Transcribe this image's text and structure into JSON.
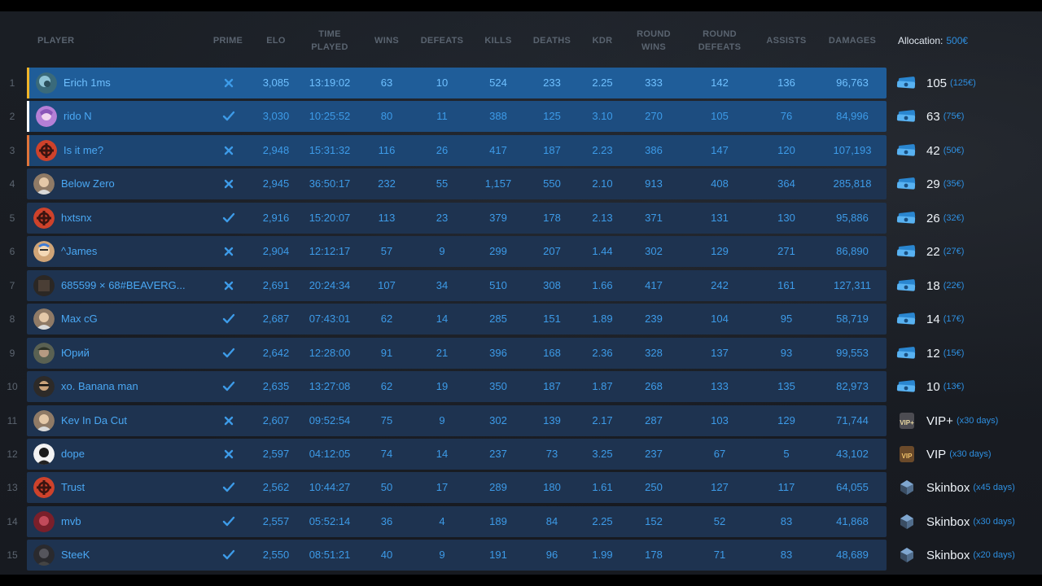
{
  "columns": {
    "player": "PLAYER",
    "prime": "PRIME",
    "elo": "ELO",
    "time_played": "TIME PLAYED",
    "wins": "WINS",
    "defeats": "DEFEATS",
    "kills": "KILLS",
    "deaths": "DEATHS",
    "kdr": "KDR",
    "round_wins": "ROUND WINS",
    "round_defeats": "ROUND DEFEATS",
    "assists": "ASSISTS",
    "damages": "DAMAGES"
  },
  "allocation": {
    "label": "Allocation:",
    "amount": "500€"
  },
  "colors": {
    "accent_blue": "#2e8fe0",
    "rank1_accent": "#f0b429",
    "rank2_accent": "#ffffff",
    "rank3_accent": "#e0743a",
    "cross": "#3d9be8",
    "check": "#3d9be8"
  },
  "rows": [
    {
      "rank": "1",
      "name": "Erich 1ms",
      "avatar": "globe-avatar",
      "prime": false,
      "elo": "3,085",
      "time": "13:19:02",
      "wins": "63",
      "defeats": "10",
      "kills": "524",
      "deaths": "233",
      "kdr": "2.25",
      "round_wins": "333",
      "round_defeats": "142",
      "assists": "136",
      "damages": "96,763",
      "reward": "105",
      "reward_sub": "(125€)",
      "reward_icon": "cash-icon"
    },
    {
      "rank": "2",
      "name": "rido N",
      "avatar": "anime-avatar",
      "prime": true,
      "elo": "3,030",
      "time": "10:25:52",
      "wins": "80",
      "defeats": "11",
      "kills": "388",
      "deaths": "125",
      "kdr": "3.10",
      "round_wins": "270",
      "round_defeats": "105",
      "assists": "76",
      "damages": "84,996",
      "reward": "63",
      "reward_sub": "(75€)",
      "reward_icon": "cash-icon"
    },
    {
      "rank": "3",
      "name": "Is it me?",
      "avatar": "rust-logo-avatar",
      "prime": false,
      "elo": "2,948",
      "time": "15:31:32",
      "wins": "116",
      "defeats": "26",
      "kills": "417",
      "deaths": "187",
      "kdr": "2.23",
      "round_wins": "386",
      "round_defeats": "147",
      "assists": "120",
      "damages": "107,193",
      "reward": "42",
      "reward_sub": "(50€)",
      "reward_icon": "cash-icon"
    },
    {
      "rank": "4",
      "name": "Below Zero",
      "avatar": "face-avatar",
      "prime": false,
      "elo": "2,945",
      "time": "36:50:17",
      "wins": "232",
      "defeats": "55",
      "kills": "1,157",
      "deaths": "550",
      "kdr": "2.10",
      "round_wins": "913",
      "round_defeats": "408",
      "assists": "364",
      "damages": "285,818",
      "reward": "29",
      "reward_sub": "(35€)",
      "reward_icon": "cash-icon"
    },
    {
      "rank": "5",
      "name": "hxtsnx",
      "avatar": "rust-logo-avatar",
      "prime": true,
      "elo": "2,916",
      "time": "15:20:07",
      "wins": "113",
      "defeats": "23",
      "kills": "379",
      "deaths": "178",
      "kdr": "2.13",
      "round_wins": "371",
      "round_defeats": "131",
      "assists": "130",
      "damages": "95,886",
      "reward": "26",
      "reward_sub": "(32€)",
      "reward_icon": "cash-icon"
    },
    {
      "rank": "6",
      "name": "^James",
      "avatar": "cartoon-avatar",
      "prime": false,
      "elo": "2,904",
      "time": "12:12:17",
      "wins": "57",
      "defeats": "9",
      "kills": "299",
      "deaths": "207",
      "kdr": "1.44",
      "round_wins": "302",
      "round_defeats": "129",
      "assists": "271",
      "damages": "86,890",
      "reward": "22",
      "reward_sub": "(27€)",
      "reward_icon": "cash-icon"
    },
    {
      "rank": "7",
      "name": "685599 × 68#BEAVERG...",
      "avatar": "dark-square-avatar",
      "prime": false,
      "elo": "2,691",
      "time": "20:24:34",
      "wins": "107",
      "defeats": "34",
      "kills": "510",
      "deaths": "308",
      "kdr": "1.66",
      "round_wins": "417",
      "round_defeats": "242",
      "assists": "161",
      "damages": "127,311",
      "reward": "18",
      "reward_sub": "(22€)",
      "reward_icon": "cash-icon"
    },
    {
      "rank": "8",
      "name": "Max cG",
      "avatar": "face-avatar",
      "prime": true,
      "elo": "2,687",
      "time": "07:43:01",
      "wins": "62",
      "defeats": "14",
      "kills": "285",
      "deaths": "151",
      "kdr": "1.89",
      "round_wins": "239",
      "round_defeats": "104",
      "assists": "95",
      "damages": "58,719",
      "reward": "14",
      "reward_sub": "(17€)",
      "reward_icon": "cash-icon"
    },
    {
      "rank": "9",
      "name": "Юрий",
      "avatar": "soldier-avatar",
      "prime": true,
      "elo": "2,642",
      "time": "12:28:00",
      "wins": "91",
      "defeats": "21",
      "kills": "396",
      "deaths": "168",
      "kdr": "2.36",
      "round_wins": "328",
      "round_defeats": "137",
      "assists": "93",
      "damages": "99,553",
      "reward": "12",
      "reward_sub": "(15€)",
      "reward_icon": "cash-icon"
    },
    {
      "rank": "10",
      "name": "xo. Banana man",
      "avatar": "character-avatar",
      "prime": true,
      "elo": "2,635",
      "time": "13:27:08",
      "wins": "62",
      "defeats": "19",
      "kills": "350",
      "deaths": "187",
      "kdr": "1.87",
      "round_wins": "268",
      "round_defeats": "133",
      "assists": "135",
      "damages": "82,973",
      "reward": "10",
      "reward_sub": "(13€)",
      "reward_icon": "cash-icon"
    },
    {
      "rank": "11",
      "name": "Kev In Da Cut",
      "avatar": "face-avatar",
      "prime": false,
      "elo": "2,607",
      "time": "09:52:54",
      "wins": "75",
      "defeats": "9",
      "kills": "302",
      "deaths": "139",
      "kdr": "2.17",
      "round_wins": "287",
      "round_defeats": "103",
      "assists": "129",
      "damages": "71,744",
      "reward": "VIP+",
      "reward_sub": "(x30 days)",
      "reward_icon": "vip-plus-icon"
    },
    {
      "rank": "12",
      "name": "dope",
      "avatar": "bw-avatar",
      "prime": false,
      "elo": "2,597",
      "time": "04:12:05",
      "wins": "74",
      "defeats": "14",
      "kills": "237",
      "deaths": "73",
      "kdr": "3.25",
      "round_wins": "237",
      "round_defeats": "67",
      "assists": "5",
      "damages": "43,102",
      "reward": "VIP",
      "reward_sub": "(x30 days)",
      "reward_icon": "vip-icon"
    },
    {
      "rank": "13",
      "name": "Trust",
      "avatar": "rust-logo-avatar",
      "prime": true,
      "elo": "2,562",
      "time": "10:44:27",
      "wins": "50",
      "defeats": "17",
      "kills": "289",
      "deaths": "180",
      "kdr": "1.61",
      "round_wins": "250",
      "round_defeats": "127",
      "assists": "117",
      "damages": "64,055",
      "reward": "Skinbox",
      "reward_sub": "(x45 days)",
      "reward_icon": "skinbox-icon"
    },
    {
      "rank": "14",
      "name": "mvb",
      "avatar": "red-avatar",
      "prime": true,
      "elo": "2,557",
      "time": "05:52:14",
      "wins": "36",
      "defeats": "4",
      "kills": "189",
      "deaths": "84",
      "kdr": "2.25",
      "round_wins": "152",
      "round_defeats": "52",
      "assists": "83",
      "damages": "41,868",
      "reward": "Skinbox",
      "reward_sub": "(x30 days)",
      "reward_icon": "skinbox-icon"
    },
    {
      "rank": "15",
      "name": "SteeK",
      "avatar": "dark-avatar",
      "prime": true,
      "elo": "2,550",
      "time": "08:51:21",
      "wins": "40",
      "defeats": "9",
      "kills": "191",
      "deaths": "96",
      "kdr": "1.99",
      "round_wins": "178",
      "round_defeats": "71",
      "assists": "83",
      "damages": "48,689",
      "reward": "Skinbox",
      "reward_sub": "(x20 days)",
      "reward_icon": "skinbox-icon"
    }
  ]
}
